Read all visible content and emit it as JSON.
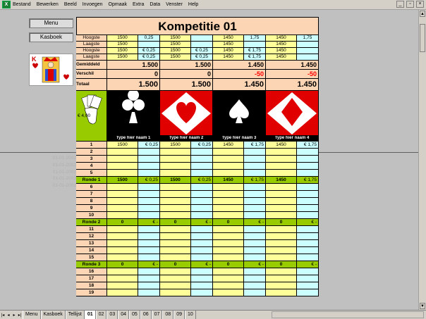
{
  "menu": [
    "Bestand",
    "Bewerken",
    "Beeld",
    "Invoegen",
    "Opmaak",
    "Extra",
    "Data",
    "Venster",
    "Help"
  ],
  "buttons": {
    "menu": "Menu",
    "kasboek": "Kasboek"
  },
  "title": "Kompetitie 01",
  "header_rows": {
    "labels": [
      "Hoogste",
      "Laagste",
      "Hoogste",
      "Laagste"
    ],
    "p1": [
      "1500",
      "1500",
      "1500",
      "1500"
    ],
    "p1_side": [
      "0,25",
      "",
      "€ 0,25",
      "€ 0,25"
    ],
    "p2": [
      "1500",
      "1500",
      "1500",
      "1500"
    ],
    "p2_side": [
      "",
      "",
      "€ 0,25",
      "€ 0,25"
    ],
    "p3": [
      "1450",
      "1450",
      "1450",
      "1450"
    ],
    "p3_side": [
      "1,75",
      "",
      "€ 1,75",
      "€ 1,75"
    ],
    "p4": [
      "1450",
      "1450",
      "1450",
      "1450"
    ],
    "p4_side": [
      "1,75",
      "",
      "",
      ""
    ]
  },
  "summary": {
    "gemiddeld_label": "Gemiddeld",
    "verschil_label": "Verschil",
    "totaal_label": "Totaal",
    "gemiddeld": [
      "1.500",
      "1.500",
      "1.450",
      "1.450"
    ],
    "verschil": [
      "0",
      "0",
      "-50",
      "-50"
    ],
    "totaal": [
      "1.500",
      "1.500",
      "1.450",
      "1.450"
    ]
  },
  "pot": "€ 4,00",
  "names": [
    "Type hier naam 1",
    "Type hier naam 2",
    "Type hier naam 3",
    "Type hier naam 4"
  ],
  "dates": [
    "01-01-2002",
    "01-01-2002",
    "01-01-2002",
    "01-01-2002",
    "01-01-2002"
  ],
  "ronde_labels": [
    "Ronde 1",
    "Ronde 2",
    "Ronde 3"
  ],
  "round1_rows": [
    "1",
    "2",
    "3",
    "4",
    "5"
  ],
  "round2_rows": [
    "6",
    "7",
    "8",
    "9",
    "10"
  ],
  "round3_rows": [
    "11",
    "12",
    "13",
    "14",
    "15"
  ],
  "round4_rows": [
    "16",
    "17",
    "18",
    "19"
  ],
  "row1": {
    "scores": [
      "1500",
      "1500",
      "1450",
      "1450"
    ],
    "eur": [
      "€ 0,25",
      "€ 0,25",
      "€ 1,75",
      "€ 1,75"
    ]
  },
  "ronde1": {
    "scores": [
      "1500",
      "1500",
      "1450",
      "1450"
    ],
    "eur": [
      "€ 0,25",
      "€ 0,25",
      "€ 1,75",
      "€ 1,75"
    ]
  },
  "ronde2": {
    "scores": [
      "0",
      "0",
      "0",
      "0"
    ],
    "eur": [
      "€ -",
      "€ -",
      "€ -",
      "€ -"
    ]
  },
  "ronde3": {
    "scores": [
      "0",
      "0",
      "0",
      "0"
    ],
    "eur": [
      "€ -",
      "€ -",
      "€ -",
      "€ -"
    ]
  },
  "tabs": [
    "Menu",
    "Kasboek",
    "Tellijst",
    "01",
    "02",
    "03",
    "04",
    "05",
    "06",
    "07",
    "08",
    "09",
    "10"
  ],
  "active_tab": "01",
  "colors": {
    "peach": "#fcd5b4",
    "yellow": "#ffff99",
    "cyan": "#ccffff",
    "lime": "#99cc00",
    "red": "#ff0000"
  }
}
